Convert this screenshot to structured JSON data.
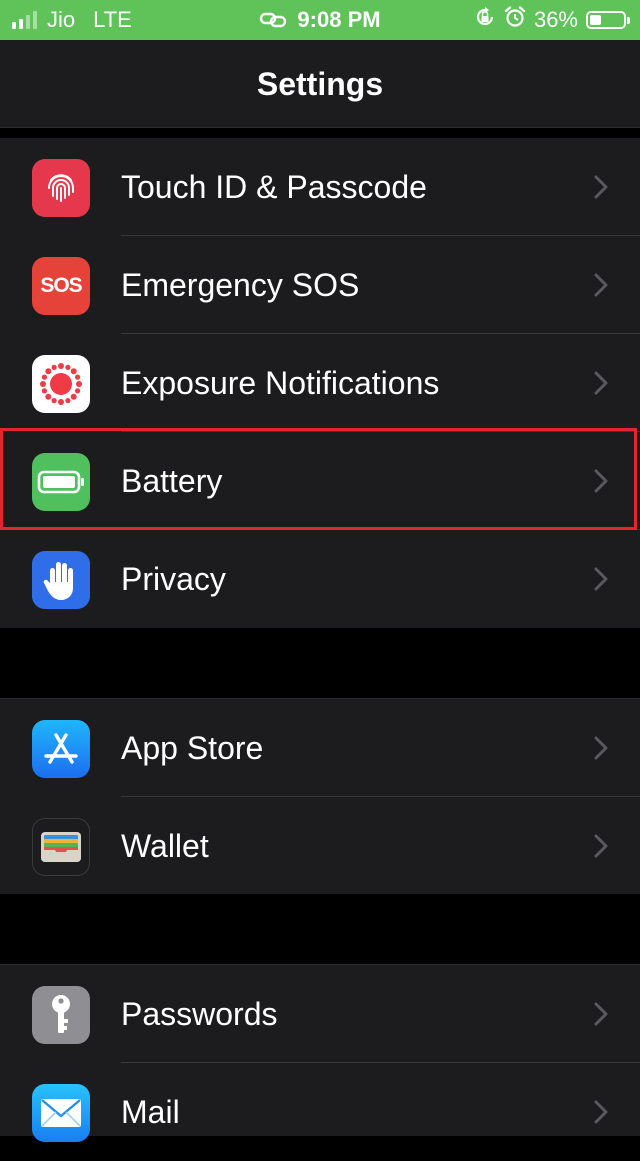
{
  "status_bar": {
    "carrier": "Jio",
    "network": "LTE",
    "time": "9:08 PM",
    "battery_percent": "36%",
    "battery_level": 0.36,
    "signal_bars_filled": 2,
    "background_color": "#5fc35a",
    "icons": [
      "signal-bars-icon",
      "link-icon",
      "orientation-lock-icon",
      "alarm-icon",
      "battery-icon"
    ]
  },
  "header": {
    "title": "Settings"
  },
  "groups": [
    {
      "items": [
        {
          "label": "Touch ID & Passcode",
          "icon": "fingerprint-icon",
          "color": "#e5384d"
        },
        {
          "label": "Emergency SOS",
          "icon": "sos-icon",
          "sos_text": "SOS",
          "color": "#e5423a"
        },
        {
          "label": "Exposure Notifications",
          "icon": "exposure-icon",
          "color": "#ffffff"
        },
        {
          "label": "Battery",
          "icon": "battery-icon",
          "color": "#4fc05d",
          "highlighted": true
        },
        {
          "label": "Privacy",
          "icon": "hand-icon",
          "color": "#2f6ee8"
        }
      ]
    },
    {
      "items": [
        {
          "label": "App Store",
          "icon": "app-store-icon",
          "color": "#1e8ef5"
        },
        {
          "label": "Wallet",
          "icon": "wallet-icon",
          "color": "#1c1c1e"
        }
      ]
    },
    {
      "items": [
        {
          "label": "Passwords",
          "icon": "key-icon",
          "color": "#8e8e93"
        },
        {
          "label": "Mail",
          "icon": "mail-icon",
          "color": "#2f8ff5"
        }
      ]
    }
  ],
  "highlight_color": "#e3262d"
}
